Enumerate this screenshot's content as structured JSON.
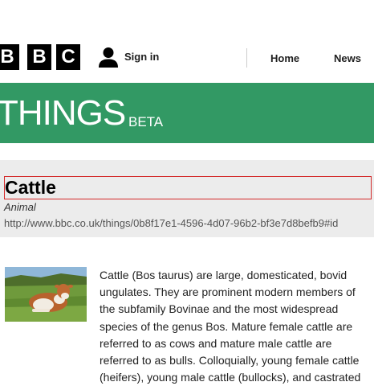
{
  "header": {
    "logo_letters": [
      "B",
      "B",
      "C"
    ],
    "signin_label": "Sign in",
    "nav": [
      {
        "label": "Home"
      },
      {
        "label": "News"
      }
    ]
  },
  "banner": {
    "title": "THINGS",
    "badge": "BETA",
    "color": "#329964"
  },
  "thing": {
    "title": "Cattle",
    "type": "Animal",
    "uri": "http://www.bbc.co.uk/things/0b8f17e1-4596-4d07-96b2-bf3e7d8befb9#id",
    "image_icon": "cow-photo",
    "description": "Cattle (Bos taurus) are large, domesticated, bovid ungulates. They are prominent modern members of the subfamily Bovinae and the most widespread species of the genus Bos. Mature female cattle are referred to as cows and mature male cattle are referred to as bulls. Colloquially, young female cattle (heifers), young male cattle (bullocks), and castrated"
  },
  "colors": {
    "accent_green": "#329964",
    "focus_outline": "#d42a2a",
    "band_gray": "#ececec"
  }
}
